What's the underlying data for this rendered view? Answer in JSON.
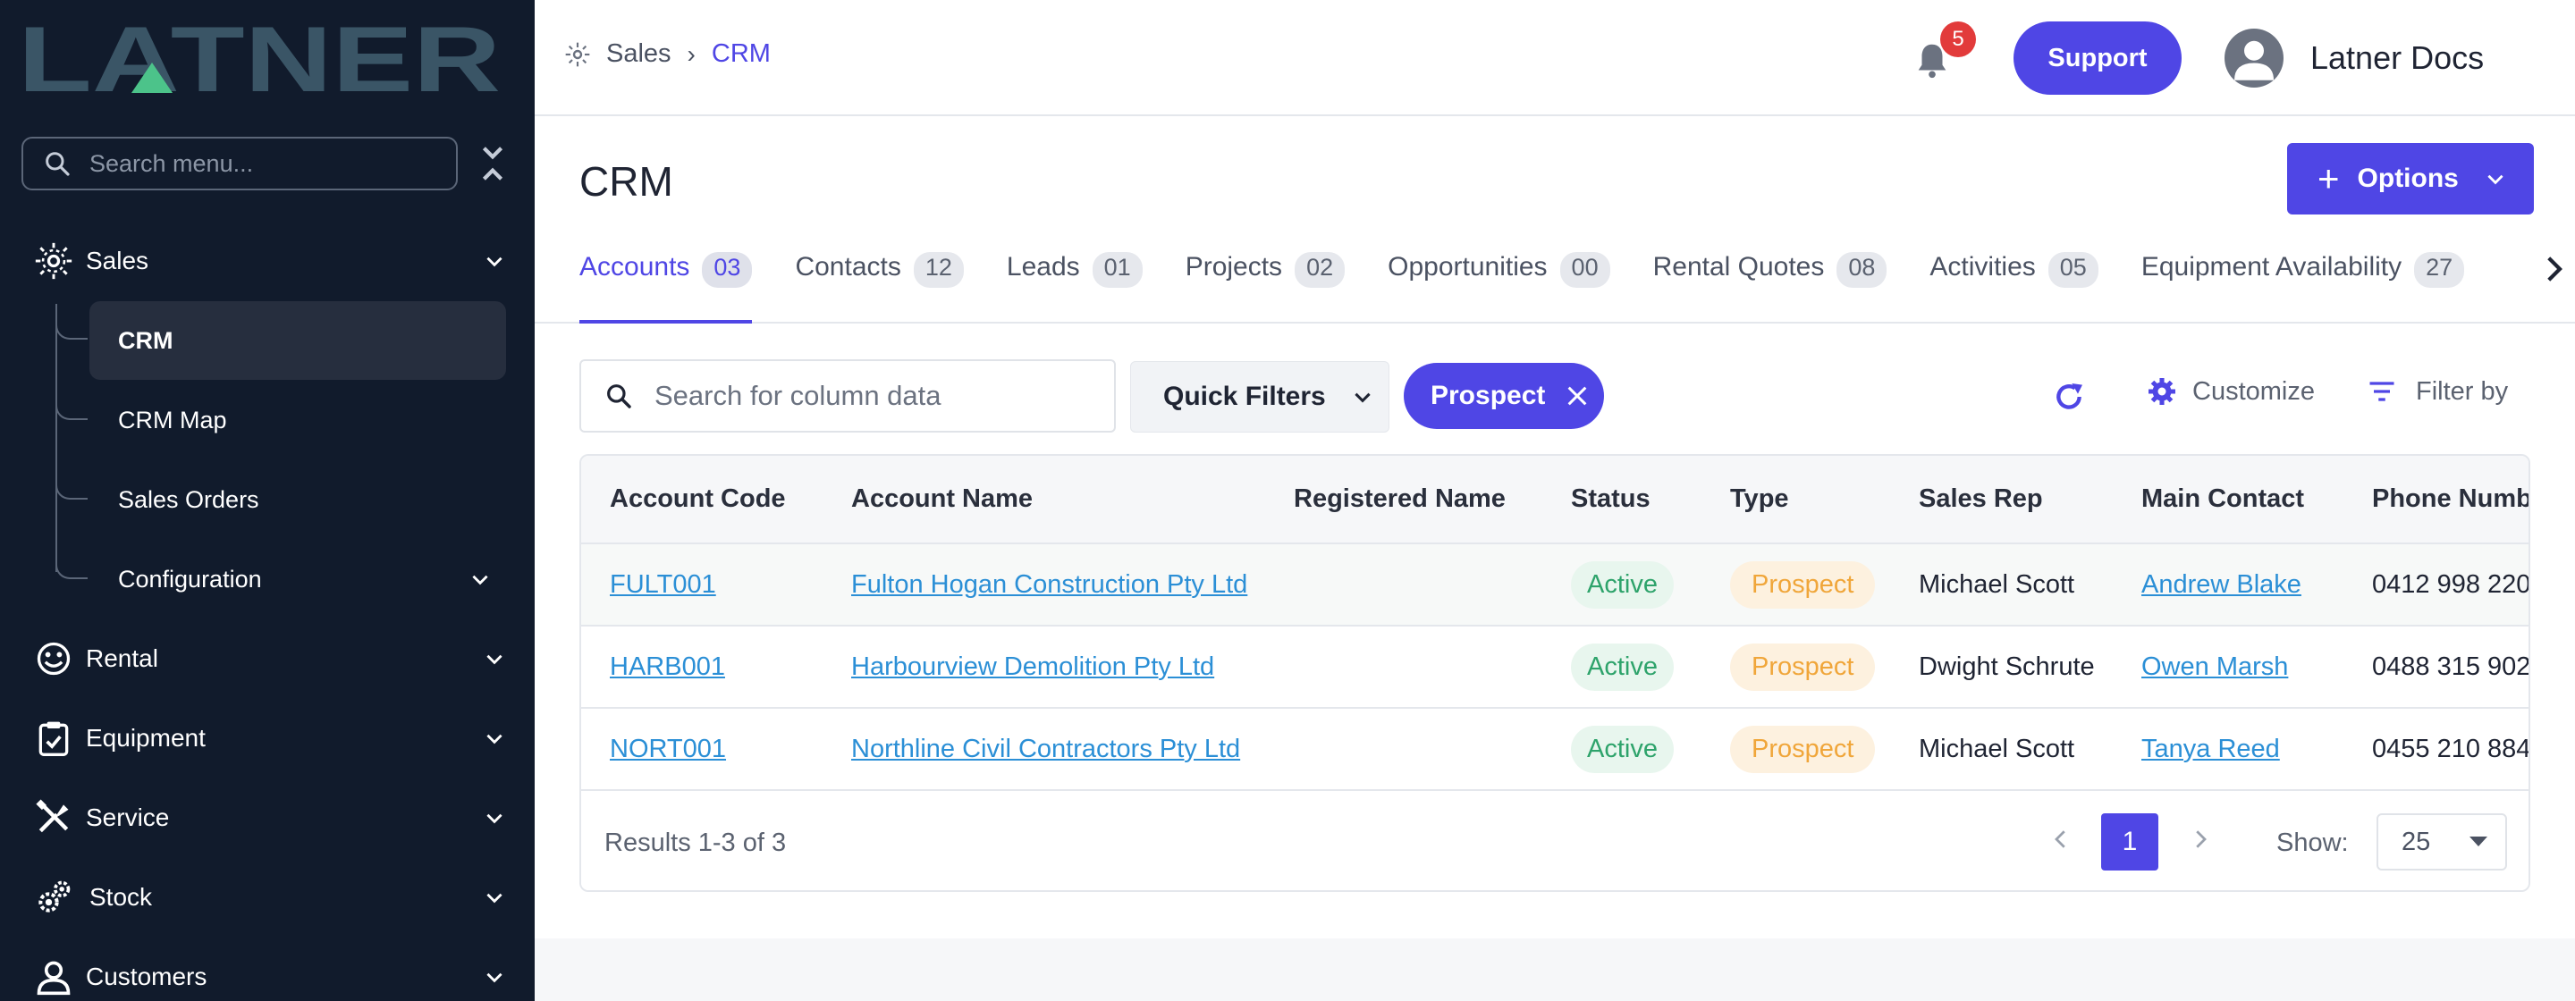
{
  "brand": {
    "logo_text": "LATNER"
  },
  "sidebar": {
    "search_placeholder": "Search menu...",
    "items": [
      {
        "label": "Sales",
        "icon": "sales-icon"
      },
      {
        "label": "Rental",
        "icon": "rental-icon"
      },
      {
        "label": "Equipment",
        "icon": "equipment-icon"
      },
      {
        "label": "Service",
        "icon": "service-icon"
      },
      {
        "label": "Stock",
        "icon": "stock-icon"
      },
      {
        "label": "Customers",
        "icon": "customers-icon"
      }
    ],
    "sales_children": [
      {
        "label": "CRM",
        "active": true
      },
      {
        "label": "CRM Map"
      },
      {
        "label": "Sales Orders"
      },
      {
        "label": "Configuration"
      }
    ]
  },
  "header": {
    "breadcrumb": [
      "Sales",
      "CRM"
    ],
    "notifications_count": "5",
    "support_label": "Support",
    "user_name": "Latner Docs"
  },
  "page": {
    "title": "CRM",
    "options_label": "Options",
    "tabs": [
      {
        "label": "Accounts",
        "count": "03"
      },
      {
        "label": "Contacts",
        "count": "12"
      },
      {
        "label": "Leads",
        "count": "01"
      },
      {
        "label": "Projects",
        "count": "02"
      },
      {
        "label": "Opportunities",
        "count": "00"
      },
      {
        "label": "Rental Quotes",
        "count": "08"
      },
      {
        "label": "Activities",
        "count": "05"
      },
      {
        "label": "Equipment Availability",
        "count": "27"
      }
    ]
  },
  "toolbar": {
    "search_placeholder": "Search for column data",
    "quick_filters_label": "Quick Filters",
    "active_filter": "Prospect",
    "customize_label": "Customize",
    "filter_by_label": "Filter by"
  },
  "table": {
    "columns": [
      "Account Code",
      "Account Name",
      "Registered Name",
      "Status",
      "Type",
      "Sales Rep",
      "Main Contact",
      "Phone Number"
    ],
    "rows": [
      {
        "code": "FULT001",
        "name": "Fulton Hogan Construction Pty Ltd",
        "registered": "",
        "status": "Active",
        "type": "Prospect",
        "rep": "Michael Scott",
        "contact": "Andrew Blake",
        "phone": "0412 998 220"
      },
      {
        "code": "HARB001",
        "name": "Harbourview Demolition Pty Ltd",
        "registered": "",
        "status": "Active",
        "type": "Prospect",
        "rep": "Dwight Schrute",
        "contact": "Owen Marsh",
        "phone": "0488 315 902"
      },
      {
        "code": "NORT001",
        "name": "Northline Civil Contractors Pty Ltd",
        "registered": "",
        "status": "Active",
        "type": "Prospect",
        "rep": "Michael Scott",
        "contact": "Tanya Reed",
        "phone": "0455 210 884"
      }
    ],
    "results_text": "Results 1-3 of 3",
    "current_page": "1",
    "show_label": "Show:",
    "page_size": "25"
  },
  "colors": {
    "accent": "#4f46e5",
    "sidebar_bg": "#111b2c",
    "link": "#2b8fd6",
    "active_green": "#2ea36b",
    "prospect_orange": "#f0a63a"
  }
}
